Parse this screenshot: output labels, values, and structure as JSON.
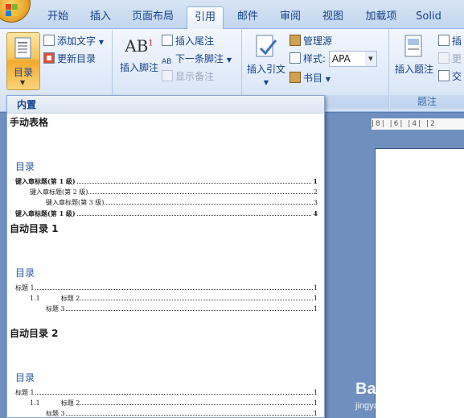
{
  "window": {
    "title_fragment": ""
  },
  "tabs": [
    {
      "label": "开始"
    },
    {
      "label": "插入"
    },
    {
      "label": "页面布局"
    },
    {
      "label": "引用",
      "active": true
    },
    {
      "label": "邮件"
    },
    {
      "label": "审阅"
    },
    {
      "label": "视图"
    },
    {
      "label": "加载项"
    },
    {
      "label": "Solid"
    }
  ],
  "ribbon": {
    "toc_group": {
      "toc_button": "目录",
      "add_text": "添加文字",
      "update_toc": "更新目录"
    },
    "footnotes_group": {
      "insert_footnote": "插入脚注",
      "insert_endnote": "插入尾注",
      "next_footnote": "下一条脚注",
      "show_notes": "显示备注",
      "footnote_icon_text": "AB",
      "footnote_icon_sup": "1"
    },
    "citations_group": {
      "insert_citation": "插入引文",
      "manage_sources": "管理源",
      "style_label": "样式:",
      "style_value": "APA",
      "bibliography": "书目",
      "group_label": "书目"
    },
    "captions_group": {
      "insert_caption": "插入题注",
      "insert_table_figures": "插",
      "update_table": "更",
      "cross_reference": "交",
      "group_label": "题注"
    }
  },
  "gallery": {
    "header": "内置",
    "items": [
      {
        "title": "手动表格",
        "toc_heading": "目录",
        "lines": [
          {
            "text": "键入章标题(第 1 级)",
            "page": "1"
          },
          {
            "text": "键入章标题(第 2 级)",
            "page": "2"
          },
          {
            "text": "键入章标题(第 3 级)",
            "page": "3"
          },
          {
            "text": "键入章标题(第 1 级)",
            "page": "4"
          }
        ]
      },
      {
        "title": "自动目录 1",
        "toc_heading": "目录",
        "lines": [
          {
            "text": "标题 1",
            "page": "1"
          },
          {
            "num": "1.1",
            "text": "标题 2",
            "page": "1"
          },
          {
            "text": "标题 3",
            "page": "1"
          }
        ]
      },
      {
        "title": "自动目录 2",
        "toc_heading": "目录",
        "lines": [
          {
            "text": "标题 1",
            "page": "1"
          },
          {
            "num": "1.1",
            "text": "标题 2",
            "page": "1"
          },
          {
            "text": "标题 3",
            "page": "1"
          }
        ]
      }
    ]
  },
  "document": {
    "ruler": "|8| |6| |4| |2"
  },
  "watermark": {
    "line1": "Bai@经验",
    "line2": "jingyan.baidu.com"
  }
}
